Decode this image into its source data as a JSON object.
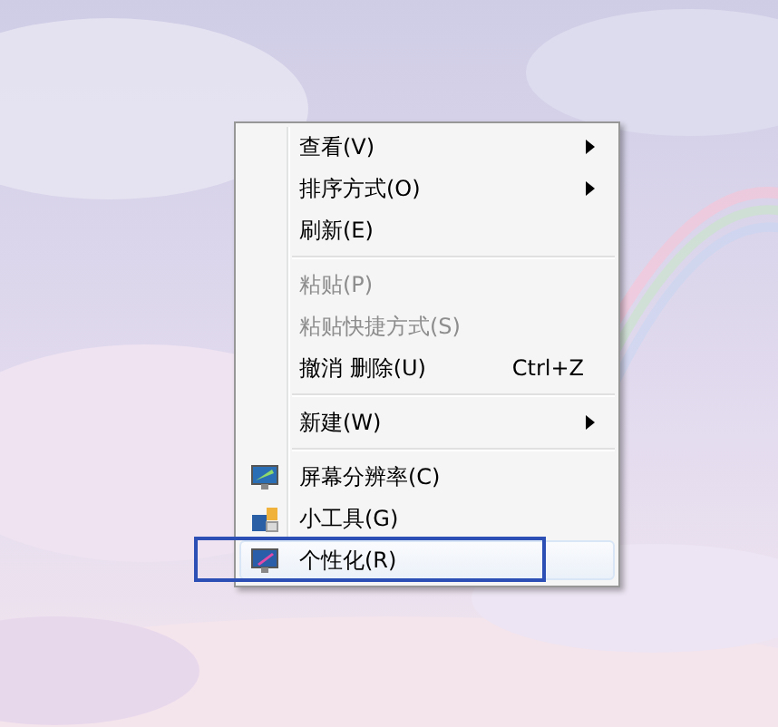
{
  "context_menu": {
    "items": [
      {
        "kind": "plain",
        "label": "查看(V)",
        "submenu": true,
        "disabled": false,
        "selected": false
      },
      {
        "kind": "plain",
        "label": "排序方式(O)",
        "submenu": true,
        "disabled": false,
        "selected": false
      },
      {
        "kind": "plain",
        "label": "刷新(E)",
        "submenu": false,
        "disabled": false,
        "selected": false
      },
      {
        "kind": "separator"
      },
      {
        "kind": "plain",
        "label": "粘贴(P)",
        "submenu": false,
        "disabled": true,
        "selected": false
      },
      {
        "kind": "plain",
        "label": "粘贴快捷方式(S)",
        "submenu": false,
        "disabled": true,
        "selected": false
      },
      {
        "kind": "plain",
        "label": "撤消 删除(U)",
        "shortcut": "Ctrl+Z",
        "submenu": false,
        "disabled": false,
        "selected": false
      },
      {
        "kind": "separator"
      },
      {
        "kind": "plain",
        "label": "新建(W)",
        "submenu": true,
        "disabled": false,
        "selected": false
      },
      {
        "kind": "separator"
      },
      {
        "kind": "monitor",
        "label": "屏幕分辨率(C)",
        "submenu": false,
        "disabled": false,
        "selected": false
      },
      {
        "kind": "gadgets",
        "label": "小工具(G)",
        "submenu": false,
        "disabled": false,
        "selected": false
      },
      {
        "kind": "personalize",
        "label": "个性化(R)",
        "submenu": false,
        "disabled": false,
        "selected": true,
        "outlined": true
      }
    ]
  }
}
